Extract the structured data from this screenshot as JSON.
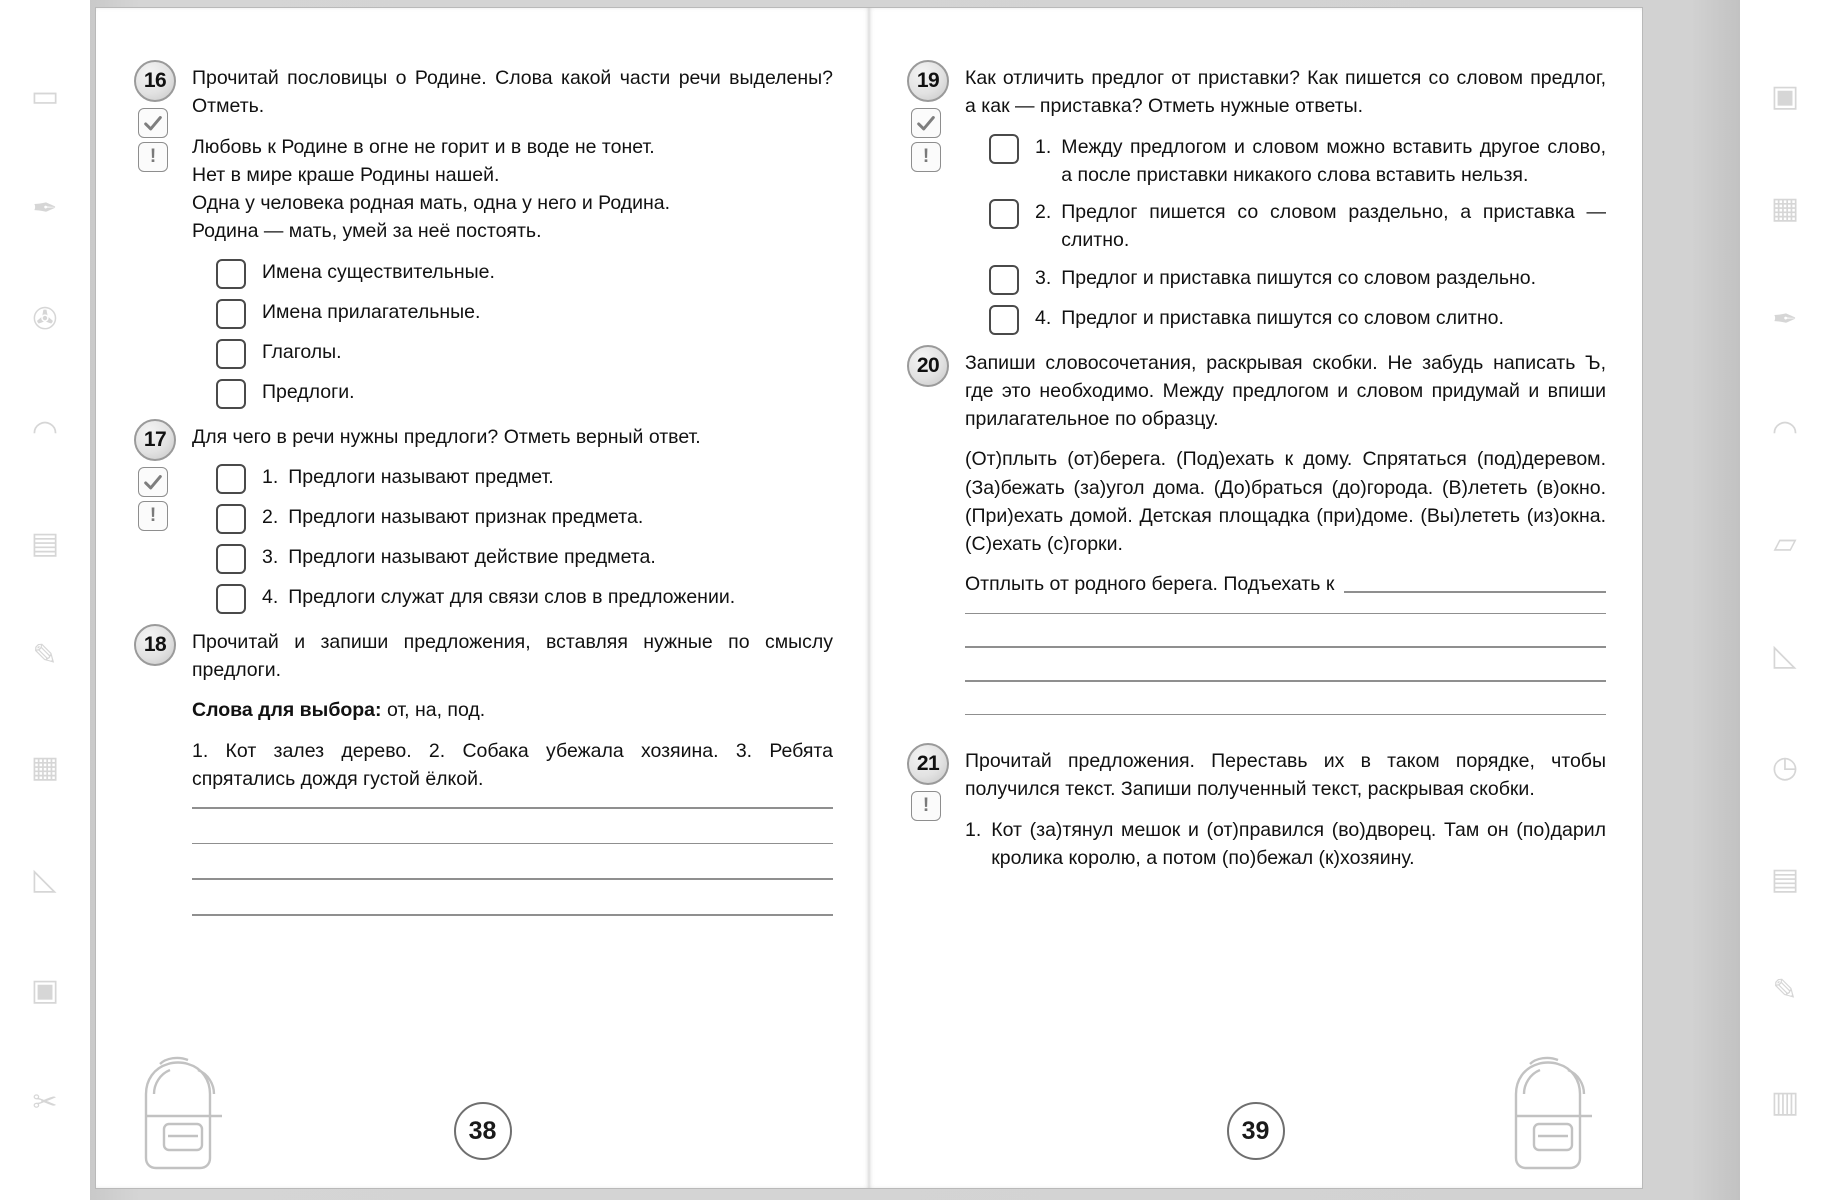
{
  "spread": {
    "left_page_number": "38",
    "right_page_number": "39"
  },
  "left_page": {
    "tasks": [
      {
        "number": "16",
        "prompt": "Прочитай пословицы о Родине. Слова какой части речи выделены?  Отметь.",
        "proverbs": [
          "Любовь к Родине в огне не горит и в воде не тонет.",
          "Нет в мире краше Родины нашей.",
          "Одна у человека родная мать, одна у него и Родина.",
          "Родина — мать, умей за неё постоять."
        ],
        "options": [
          "Имена  существительные.",
          "Имена  прилагательные.",
          "Глаголы.",
          "Предлоги."
        ]
      },
      {
        "number": "17",
        "prompt": "Для чего в речи нужны предлоги? Отметь верный ответ.",
        "options": [
          {
            "num": "1.",
            "text": "Предлоги  называют  предмет."
          },
          {
            "num": "2.",
            "text": "Предлоги  называют  признак  предмета."
          },
          {
            "num": "3.",
            "text": "Предлоги  называют  действие  предмета."
          },
          {
            "num": "4.",
            "text": "Предлоги  служат  для  связи  слов  в  предложении."
          }
        ]
      },
      {
        "number": "18",
        "prompt": "Прочитай и запиши предложения, вставляя нужные по смыслу  предлоги.",
        "words_label": "Слова  для  выбора:",
        "words_value": "от,  на,  под.",
        "sentences": "1.  Кот  залез  дерево.  2.  Собака  убежала  хозяина. 3.  Ребята  спрятались  дождя  густой  ёлкой.",
        "rule_lines": 4
      }
    ]
  },
  "right_page": {
    "tasks": [
      {
        "number": "19",
        "prompt": "Как отличить предлог от приставки? Как пишется со словом предлог, а как — приставка? Отметь нужные ответы.",
        "options": [
          {
            "num": "1.",
            "text": "Между  предлогом  и  словом  можно  вставить  другое  слово,  а  после  приставки  никакого  слова  вставить  нельзя."
          },
          {
            "num": "2.",
            "text": "Предлог пишется со словом раздельно, а приставка  —  слитно."
          },
          {
            "num": "3.",
            "text": "Предлог и приставка пишутся со словом раздельно."
          },
          {
            "num": "4.",
            "text": "Предлог и приставка пишутся со словом слитно."
          }
        ]
      },
      {
        "number": "20",
        "prompt": "Запиши словосочетания, раскрывая скобки. Не забудь написать Ъ, где это необходимо. Между предлогом и словом придумай и впиши прилагательное по образцу.",
        "body": "(От)плыть (от)берега. (Под)ехать к дому. Спрятаться (под)деревом. (За)бежать (за)угол дома. (До)браться (до)города. (В)лететь (в)окно. (При)ехать домой. Детская площадка (при)доме. (Вы)лететь (из)окна. (С)ехать (с)горки.",
        "example": "Отплыть  от  родного  берега.  Подъехать  к",
        "rule_lines": 4
      },
      {
        "number": "21",
        "prompt": "Прочитай предложения. Переставь их в таком порядке, чтобы получился текст. Запиши полученный текст, раскрывая  скобки.",
        "items": [
          {
            "num": "1.",
            "text": "Кот  (за)тянул  мешок  и  (от)правился  (во)дворец.  Там  он  (по)дарил  кролика  королю,  а  потом  (по)бежал  (к)хозяину."
          }
        ]
      }
    ]
  },
  "icons": {
    "check": "check-mark",
    "attention": "!"
  },
  "decor": {
    "left_band": [
      "✐",
      "✎",
      "◳",
      "◠",
      "▭",
      "▤",
      "◺",
      "✒",
      "▦",
      "✇"
    ],
    "right_band": [
      "✂",
      "▣",
      "✎",
      "◠",
      "▱",
      "✦",
      "◷",
      "▤",
      "✐",
      "▥"
    ]
  }
}
